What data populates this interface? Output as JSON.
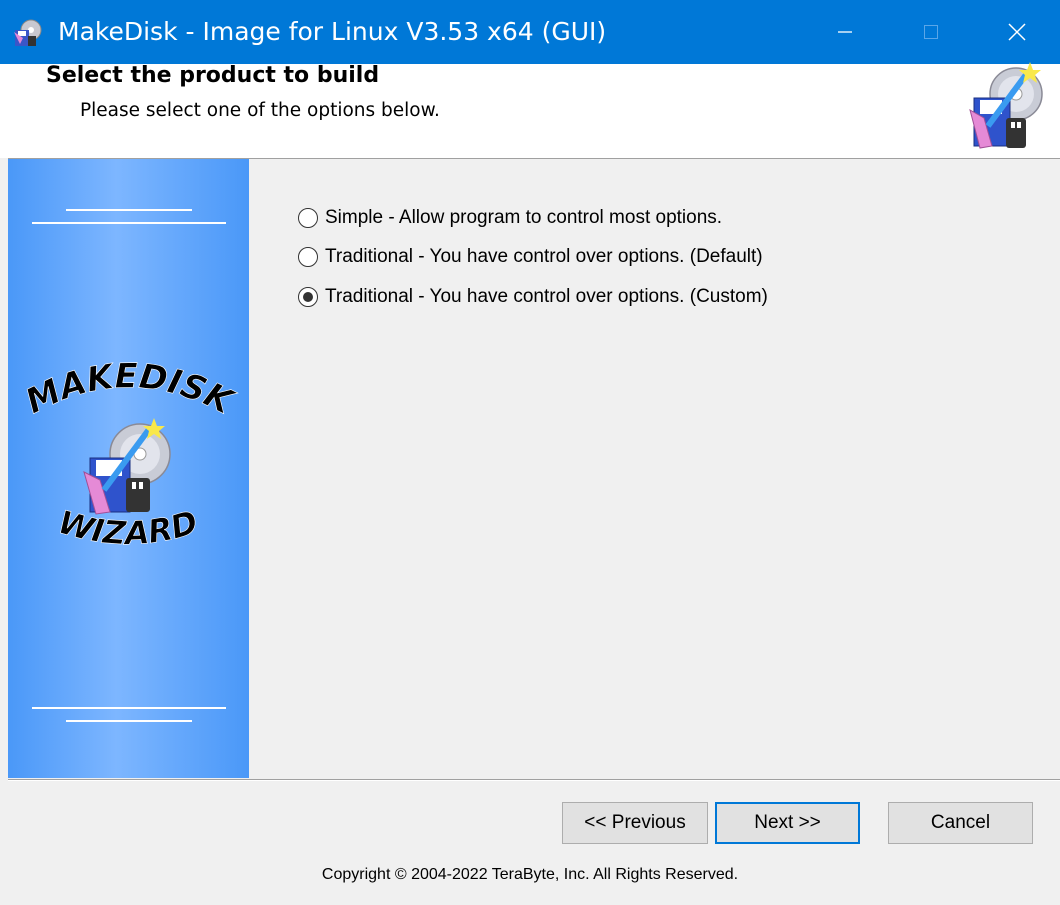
{
  "window": {
    "title": "MakeDisk - Image for Linux V3.53 x64 (GUI)",
    "accent_color": "#0078d7",
    "controls": [
      "minimize-icon",
      "maximize-icon",
      "close-icon"
    ]
  },
  "header": {
    "title": "Select the product to build",
    "subtitle": "Please select one of the options below."
  },
  "sidebar": {
    "logo_top": "MAKEDISK",
    "logo_bottom": "WIZARD"
  },
  "options": [
    {
      "label": "Simple - Allow program to control most options.",
      "selected": false
    },
    {
      "label": "Traditional - You have control over options. (Default)",
      "selected": false
    },
    {
      "label": "Traditional - You have control over options. (Custom)",
      "selected": true
    }
  ],
  "buttons": {
    "previous": "<< Previous",
    "next": "Next >>",
    "cancel": "Cancel"
  },
  "footer": {
    "copyright": "Copyright © 2004-2022 TeraByte, Inc.  All Rights Reserved."
  }
}
